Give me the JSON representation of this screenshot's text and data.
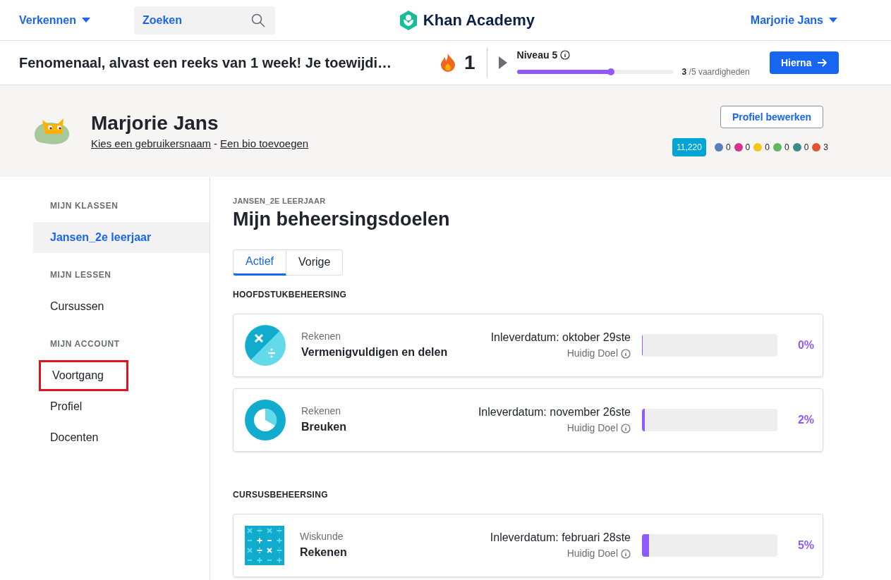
{
  "header": {
    "explore": "Verkennen",
    "search": {
      "placeholder": "Zoeken"
    },
    "logo": "Khan Academy",
    "user": "Marjorie Jans"
  },
  "streak_bar": {
    "message": "Fenomenaal, alvast een reeks van 1 week! Je toewijdi…",
    "streak": "1",
    "level_title": "Niveau 5",
    "level": 0.6,
    "skills_done": "3",
    "skills_total": "/5 vaardigheden",
    "next_button": "Hierna"
  },
  "profile": {
    "name": "Marjorie Jans",
    "username_link": "Kies een gebruikersnaam",
    "separator": "-",
    "bio_link": "Een bio toevoegen",
    "edit_button": "Profiel bewerken",
    "points": "11,220",
    "badges": [
      {
        "color": "#5a7fb5",
        "count": "0"
      },
      {
        "color": "#d6338a",
        "count": "0"
      },
      {
        "color": "#f5c518",
        "count": "0"
      },
      {
        "color": "#5cb85c",
        "count": "0"
      },
      {
        "color": "#3c8c8c",
        "count": "0"
      },
      {
        "color": "#e0552d",
        "count": "3"
      }
    ]
  },
  "sidebar": {
    "sections": [
      {
        "title": "MIJN KLASSEN",
        "items": [
          {
            "label": "Jansen_2e leerjaar",
            "selected": true,
            "highlighted": false
          }
        ]
      },
      {
        "title": "MIJN LESSEN",
        "items": [
          {
            "label": "Cursussen",
            "selected": false,
            "highlighted": false
          }
        ]
      },
      {
        "title": "MIJN ACCOUNT",
        "items": [
          {
            "label": "Voortgang",
            "selected": false,
            "highlighted": true
          },
          {
            "label": "Profiel",
            "selected": false,
            "highlighted": false
          },
          {
            "label": "Docenten",
            "selected": false,
            "highlighted": false
          }
        ]
      }
    ]
  },
  "main": {
    "class_label": "JANSEN_2E LEERJAAR",
    "title": "Mijn beheersingsdoelen",
    "tabs": [
      {
        "label": "Actief",
        "selected": true
      },
      {
        "label": "Vorige",
        "selected": false
      }
    ],
    "groups": [
      {
        "title": "HOOFDSTUKBEHEERSING",
        "goals": [
          {
            "kind": "multiply",
            "subject": "Rekenen",
            "name": "Vermenigvuldigen en delen",
            "due": "Inleverdatum: oktober 29ste",
            "goal_label": "Huidig Doel",
            "level": 0,
            "percent": "0%"
          },
          {
            "kind": "fraction",
            "subject": "Rekenen",
            "name": "Breuken",
            "due": "Inleverdatum: november 26ste",
            "goal_label": "Huidig Doel",
            "level": 0.02,
            "percent": "2%"
          }
        ]
      },
      {
        "title": "CURSUSBEHEERSING",
        "goals": [
          {
            "kind": "math",
            "subject": "Wiskunde",
            "name": "Rekenen",
            "due": "Inleverdatum: februari 28ste",
            "goal_label": "Huidig Doel",
            "level": 0.05,
            "percent": "5%"
          }
        ]
      }
    ]
  }
}
